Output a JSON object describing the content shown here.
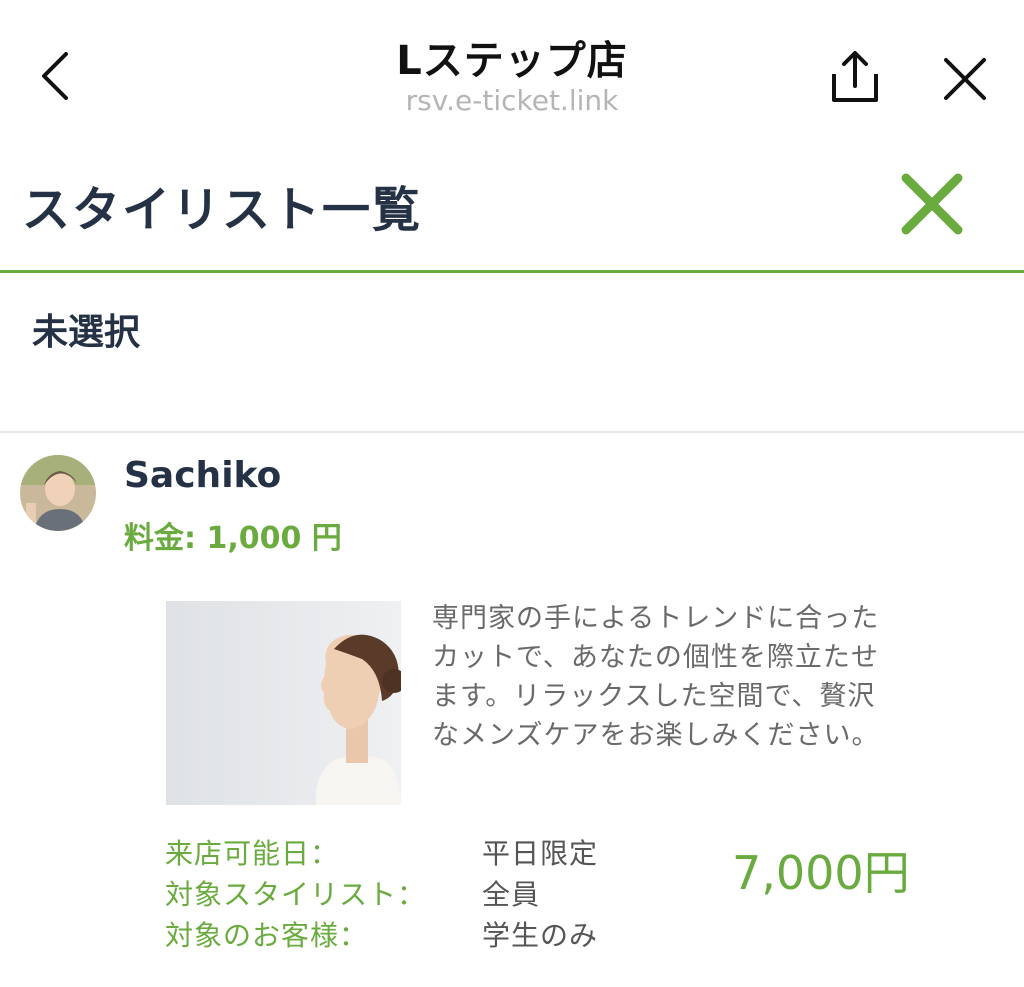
{
  "browser": {
    "title": "Lステップ店",
    "url": "rsv.e-ticket.link",
    "back_icon": "chevron-left-icon",
    "share_icon": "share-icon",
    "close_icon": "close-icon"
  },
  "modal": {
    "title": "スタイリスト一覧",
    "close_icon": "close-icon",
    "accent_color": "#6aab3f"
  },
  "unselected": {
    "label": "未選択"
  },
  "stylist": {
    "name": "Sachiko",
    "price": "料金: 1,000 円",
    "avatar_icon": "avatar"
  },
  "menu": {
    "description": "専門家の手によるトレンドに合ったカットで、あなたの個性を際立たせます。リラックスした空間で、贅沢なメンズケアをお楽しみください。",
    "details": [
      {
        "label": "来店可能日：",
        "value": "平日限定"
      },
      {
        "label": "対象スタイリスト：",
        "value": "全員"
      },
      {
        "label": "対象のお客様：",
        "value": "学生のみ"
      }
    ],
    "price": "7,000円"
  }
}
